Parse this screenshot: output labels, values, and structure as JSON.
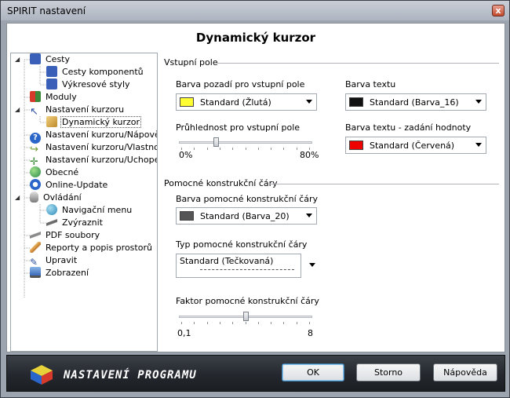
{
  "window": {
    "title": "SPIRIT nastavení",
    "close_glyph": "x"
  },
  "header": {
    "title": "Dynamický kurzor"
  },
  "tree": {
    "items": [
      {
        "label": "Cesty",
        "icon": "books-icon",
        "color": "#3a5fb8"
      },
      {
        "label": "Cesty komponentů",
        "icon": "books-icon",
        "color": "#3a5fb8"
      },
      {
        "label": "Výkresové styly",
        "icon": "books-icon",
        "color": "#3a5fb8"
      },
      {
        "label": "Moduly",
        "icon": "modules-icon",
        "color": "#d63a2a"
      },
      {
        "label": "Nastavení kurzoru",
        "icon": "cursor-icon",
        "color": "#2a4f9e"
      },
      {
        "label": "Dynamický kurzor",
        "icon": "ruler-icon",
        "color": "#c08a2a"
      },
      {
        "label": "Nastavení kurzoru/Nápověda",
        "icon": "help-icon",
        "color": "#2a66c9"
      },
      {
        "label": "Nastavení kurzoru/Vlastnosti",
        "icon": "properties-icon",
        "color": "#6a9a2a"
      },
      {
        "label": "Nastavení kurzoru/Uchopení",
        "icon": "snap-icon",
        "color": "#3a8a3a"
      },
      {
        "label": "Obecné",
        "icon": "globe-icon",
        "color": "#2a8a4a"
      },
      {
        "label": "Online-Update",
        "icon": "update-icon",
        "color": "#2a66c9"
      },
      {
        "label": "Ovládání",
        "icon": "mouse-icon",
        "color": "#7a7a7a"
      },
      {
        "label": "Navigační menu",
        "icon": "globe-icon",
        "color": "#2a8ab8"
      },
      {
        "label": "Zvýraznit",
        "icon": "pen-icon",
        "color": "#6a6a6a"
      },
      {
        "label": "PDF soubory",
        "icon": "pdf-icon",
        "color": "#8a8a8a"
      },
      {
        "label": "Reporty a popis prostorů",
        "icon": "pencil-icon",
        "color": "#c07a2a"
      },
      {
        "label": "Upravit",
        "icon": "edit-icon",
        "color": "#2a4f9e"
      },
      {
        "label": "Zobrazení",
        "icon": "monitor-icon",
        "color": "#3a6ab8"
      }
    ]
  },
  "section_input": {
    "title": "Vstupní pole",
    "bg_label": "Barva pozadí pro vstupní pole",
    "bg_value": "Standard (Žlutá)",
    "bg_color": "#ffff33",
    "text_label": "Barva textu",
    "text_value": "Standard (Barva_16)",
    "text_color": "#111111",
    "transp_label": "Průhlednost pro vstupní pole",
    "transp_min": "0%",
    "transp_max": "80%",
    "transp_fraction": 0.27,
    "text_input_label": "Barva textu - zadání hodnoty",
    "text_input_value": "Standard (Červená)",
    "text_input_color": "#ee0000"
  },
  "section_lines": {
    "title": "Pomocné konstrukční čáry",
    "color_label": "Barva pomocné konstrukční čáry",
    "color_value": "Standard (Barva_20)",
    "color_swatch": "#555555",
    "type_label": "Typ pomocné konstrukční čáry",
    "type_value": "Standard (Tečkovaná)",
    "factor_label": "Faktor pomocné konstrukční čáry",
    "factor_min": "0,1",
    "factor_max": "8",
    "factor_fraction": 0.5
  },
  "footer": {
    "brand": "NASTAVENÍ PROGRAMU",
    "ok": "OK",
    "cancel": "Storno",
    "help": "Nápověda"
  }
}
